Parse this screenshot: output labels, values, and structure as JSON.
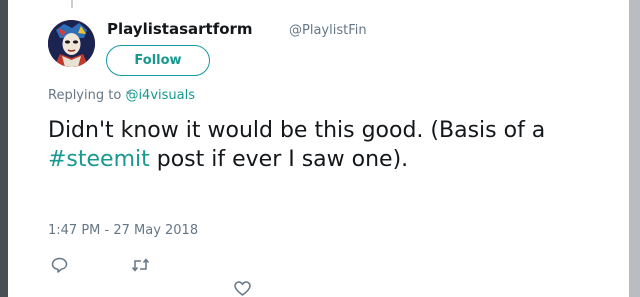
{
  "tweet": {
    "display_name": "Playlistasartform",
    "handle": "@PlaylistFin",
    "follow_label": "Follow",
    "replying_prefix": "Replying to ",
    "replying_mention": "@i4visuals",
    "text_before_hashtag": "Didn't know it would be this good. (Basis of a ",
    "hashtag": "#steemit",
    "text_after_hashtag": " post if ever I saw one).",
    "timestamp": "1:47 PM - 27 May 2018"
  },
  "icons": {
    "reply": "reply-icon",
    "retweet": "retweet-icon",
    "like": "heart-icon"
  },
  "colors": {
    "accent": "#17998f",
    "text": "#14171a",
    "muted": "#657786"
  }
}
